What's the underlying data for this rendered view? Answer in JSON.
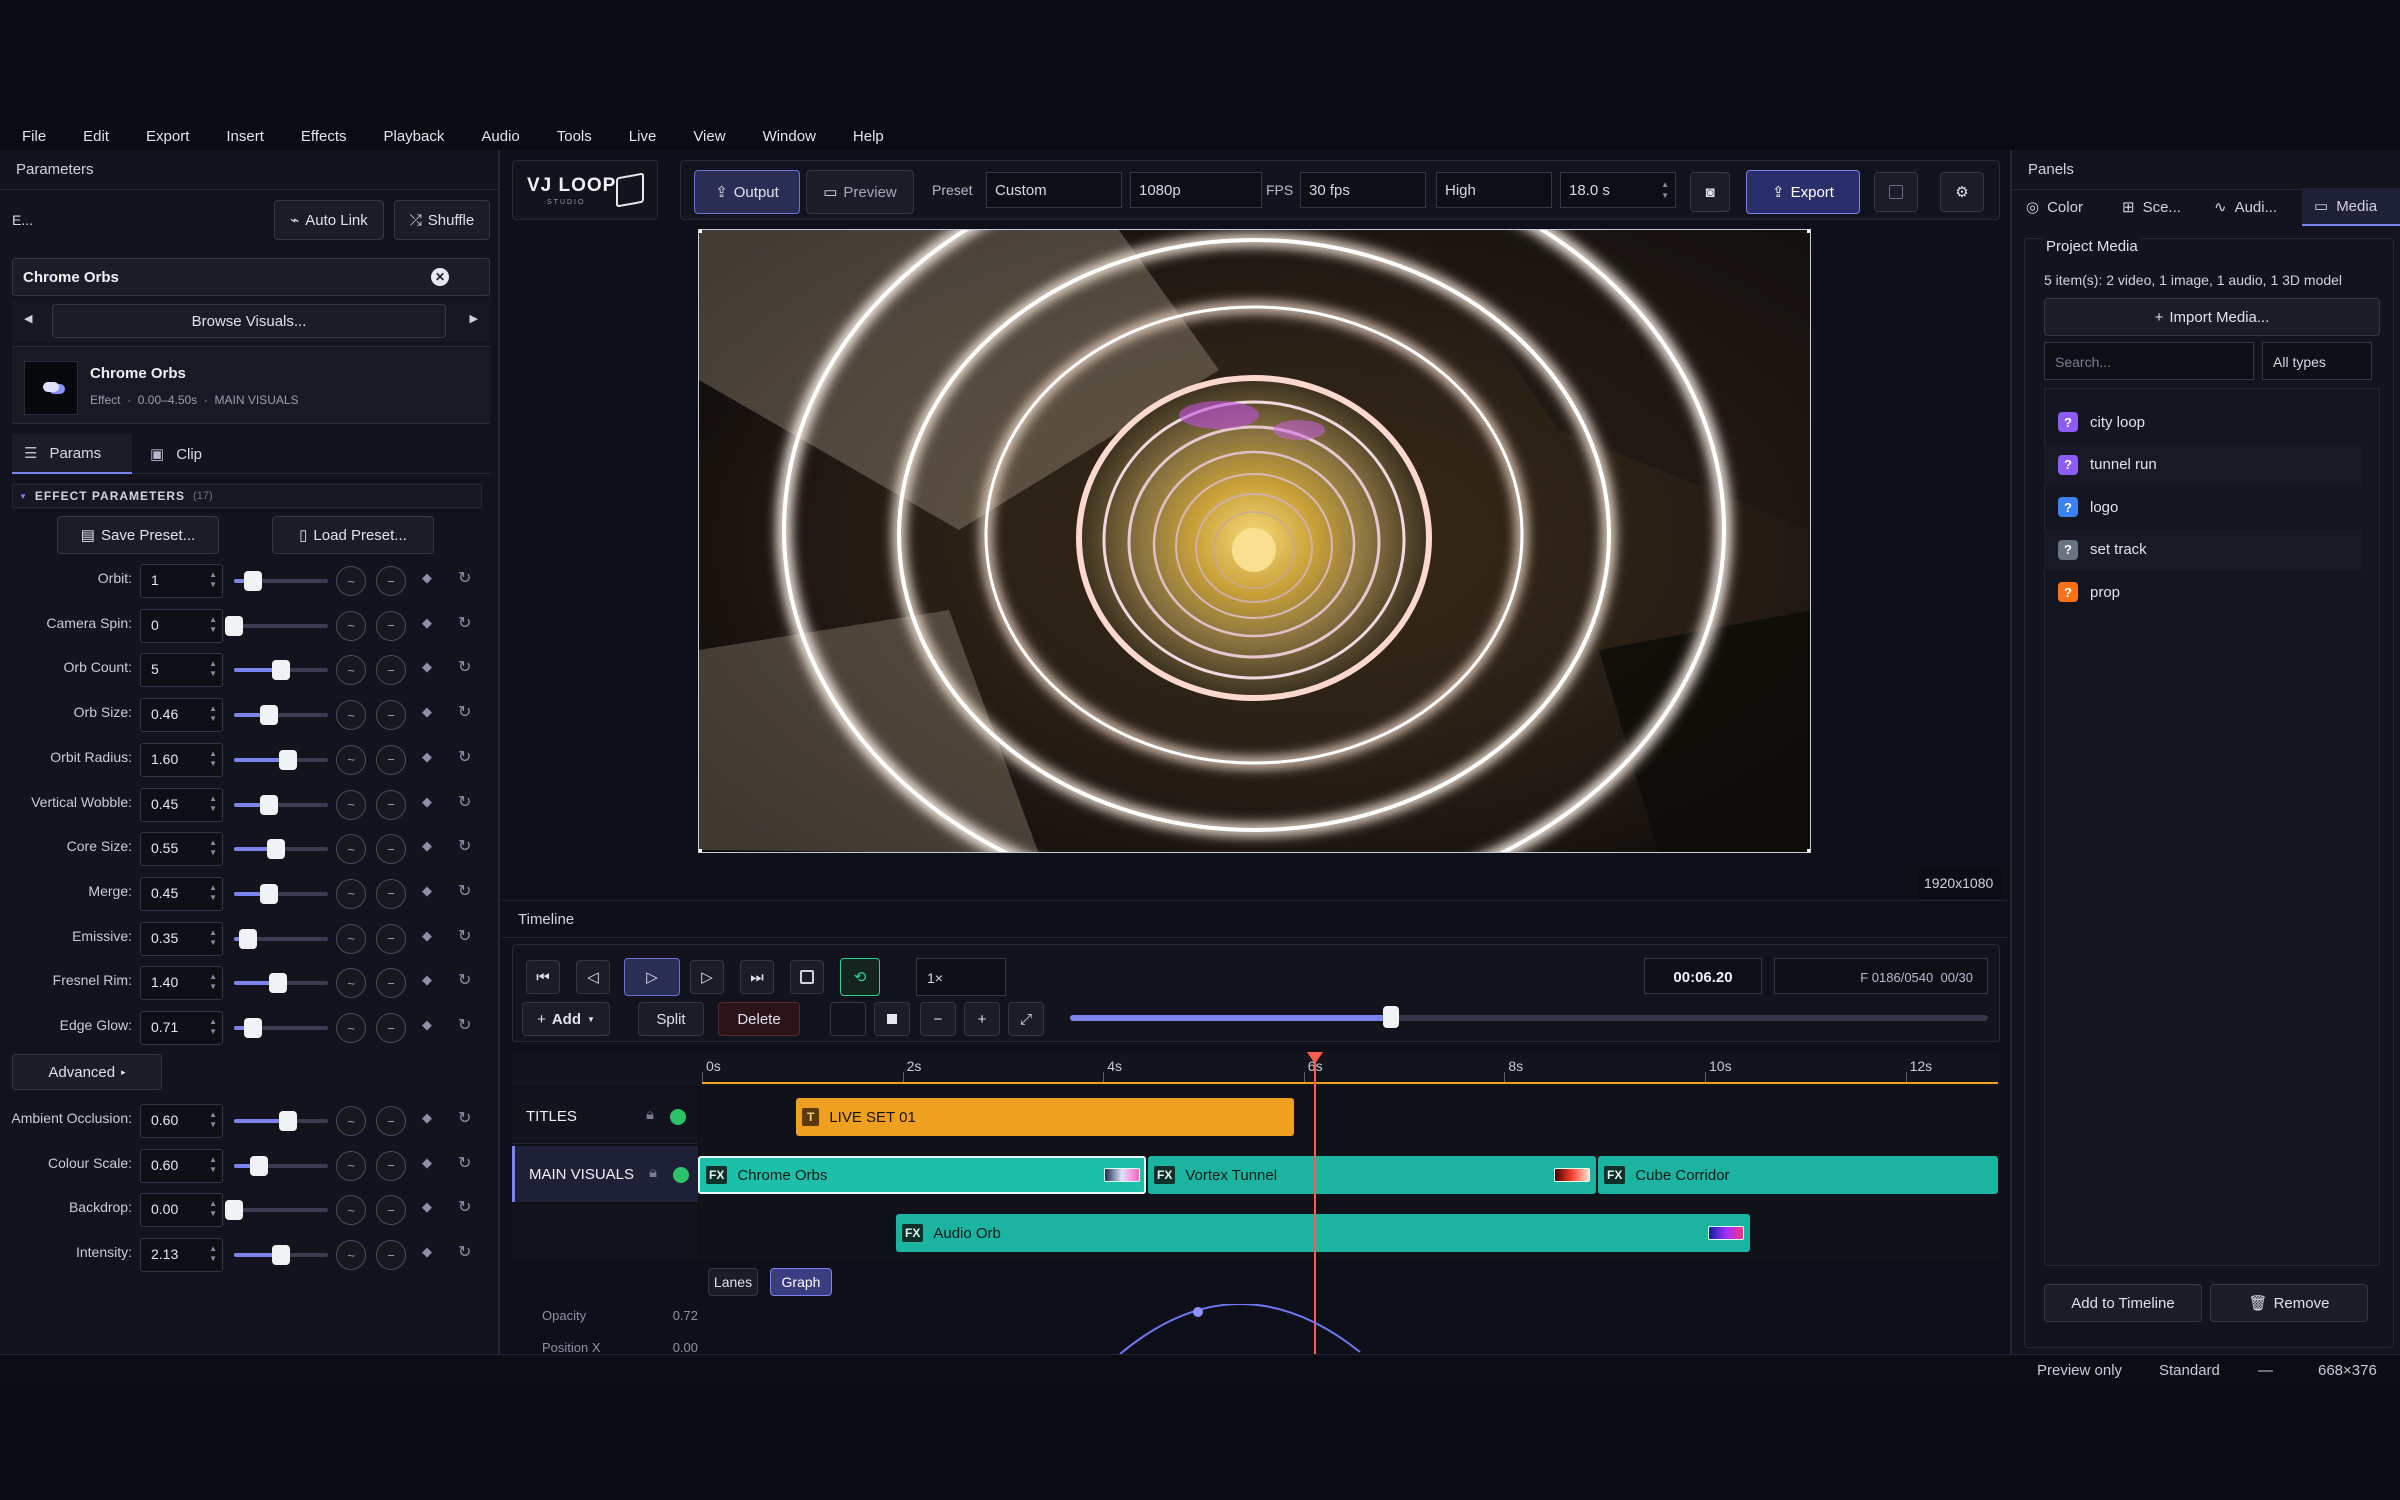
{
  "menu": [
    "File",
    "Edit",
    "Export",
    "Insert",
    "Effects",
    "Playback",
    "Audio",
    "Tools",
    "Live",
    "View",
    "Window",
    "Help"
  ],
  "left": {
    "panel_title": "Parameters",
    "truncated_label": "E...",
    "auto_link": "Auto Link",
    "shuffle": "Shuffle",
    "selected_visual": "Chrome Orbs",
    "browse": "Browse Visuals...",
    "item_name": "Chrome Orbs",
    "item_meta": "Effect  ·  0.00–4.50s  ·  MAIN VISUALS",
    "tab_params": "Params",
    "tab_clip": "Clip",
    "section_title": "EFFECT PARAMETERS",
    "section_count": "(17)",
    "save_preset": "Save Preset...",
    "load_preset": "Load Preset...",
    "advanced": "Advanced",
    "params": [
      {
        "label": "Orbit:",
        "value": "1",
        "level": 0.2
      },
      {
        "label": "Camera Spin:",
        "value": "0",
        "level": 0.0
      },
      {
        "label": "Orb Count:",
        "value": "5",
        "level": 0.5
      },
      {
        "label": "Orb Size:",
        "value": "0.46",
        "level": 0.37
      },
      {
        "label": "Orbit Radius:",
        "value": "1.60",
        "level": 0.57
      },
      {
        "label": "Vertical Wobble:",
        "value": "0.45",
        "level": 0.37
      },
      {
        "label": "Core Size:",
        "value": "0.55",
        "level": 0.45
      },
      {
        "label": "Merge:",
        "value": "0.45",
        "level": 0.37
      },
      {
        "label": "Emissive:",
        "value": "0.35",
        "level": 0.15
      },
      {
        "label": "Fresnel Rim:",
        "value": "1.40",
        "level": 0.47
      },
      {
        "label": "Edge Glow:",
        "value": "0.71",
        "level": 0.2
      }
    ],
    "advanced_params": [
      {
        "label": "Ambient Occlusion:",
        "value": "0.60",
        "level": 0.57
      },
      {
        "label": "Colour Scale:",
        "value": "0.60",
        "level": 0.27
      },
      {
        "label": "Backdrop:",
        "value": "0.00",
        "level": 0.0
      },
      {
        "label": "Intensity:",
        "value": "2.13",
        "level": 0.5
      }
    ]
  },
  "toolbar": {
    "logo": "VJ LOOP",
    "logo_sub": "STUDIO",
    "output": "Output",
    "preview": "Preview",
    "preset_label": "Preset",
    "preset_value": "Custom",
    "resolution": "1080p",
    "fps_label": "FPS",
    "fps_value": "30 fps",
    "quality": "High",
    "duration": "18.0 s",
    "export": "Export"
  },
  "viewer": {
    "resolution_badge": "1920x1080"
  },
  "timeline": {
    "title": "Timeline",
    "speed": "1×",
    "timecode": "00:06.20",
    "frame": "F 0186/0540  00/30",
    "add": "Add",
    "split": "Split",
    "delete": "Delete",
    "scrub_position": 0.35,
    "ruler": [
      "0s",
      "2s",
      "4s",
      "6s",
      "8s",
      "10s",
      "12s"
    ],
    "tracks": [
      {
        "name": "TITLES"
      },
      {
        "name": "MAIN VISUALS"
      }
    ],
    "clips": {
      "title_clip": "LIVE SET 01",
      "title_badge": "T",
      "fx_badge": "FX",
      "chrome": "Chrome Orbs",
      "vortex": "Vortex Tunnel",
      "cube": "Cube Corridor",
      "audio": "Audio Orb"
    },
    "lanes": "Lanes",
    "graph": "Graph",
    "props": [
      {
        "label": "Opacity",
        "value": "0.72"
      },
      {
        "label": "Position X",
        "value": "0.00"
      }
    ]
  },
  "right": {
    "panel_title": "Panels",
    "tabs": [
      "Color",
      "Sce...",
      "Audi...",
      "Media"
    ],
    "section": "Project Media",
    "summary": "5 item(s): 2 video, 1 image, 1 audio, 1 3D model",
    "import": "Import Media...",
    "search_placeholder": "Search...",
    "filter": "All types",
    "items": [
      {
        "name": "city loop",
        "color": "#8b5cf6"
      },
      {
        "name": "tunnel run",
        "color": "#8b5cf6"
      },
      {
        "name": "logo",
        "color": "#3b82f6"
      },
      {
        "name": "set track",
        "color": "#6b7280"
      },
      {
        "name": "prop",
        "color": "#f97316"
      }
    ],
    "add_to_timeline": "Add to Timeline",
    "remove": "Remove"
  },
  "status": {
    "mode": "Preview only",
    "quality": "Standard",
    "dash": "—",
    "size": "668×376"
  },
  "colors": {
    "accent": "#7b83ee",
    "titles_clip": "#f0a020",
    "visual_clip": "#1cc0a8",
    "playhead": "#ff5c50"
  }
}
